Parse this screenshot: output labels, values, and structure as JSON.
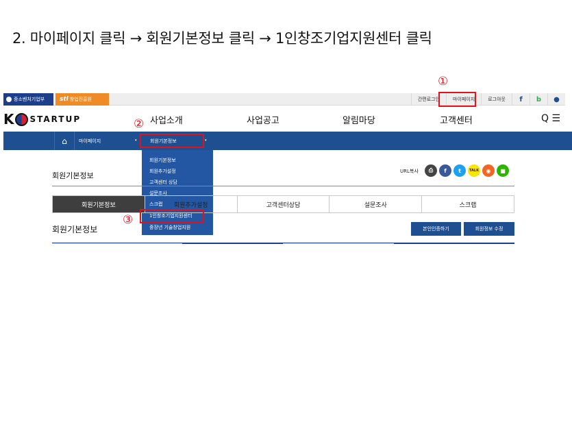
{
  "instruction": "2. 마이페이지 클릭 → 회원기본정보 클릭 → 1인창조기업지원센터 클릭",
  "util_bar": {
    "left_1": "중소벤처기업부",
    "left_2_logo": "stl",
    "left_2_label": "창업진흥원",
    "links": [
      "간편로그인",
      "마이페이지",
      "로그아웃"
    ],
    "sns": [
      "f",
      "b",
      "●"
    ]
  },
  "header": {
    "logo_k": "K",
    "logo_text": "STARTUP",
    "gnb": [
      "사업소개",
      "사업공고",
      "알림마당",
      "고객센터"
    ],
    "icons": "Q ☰"
  },
  "subnav": {
    "home_icon": "⌂",
    "crumb_1": "마이페이지",
    "crumb_2": "회원기본정보",
    "caret": "▾"
  },
  "dropdown": [
    "회원기본정보",
    "회원추가설정",
    "고객센터 상담",
    "설문조사",
    "스크랩",
    "1인창조기업지원센터",
    "중장년 기술창업지원"
  ],
  "content": {
    "page_title": "회원기본정보",
    "url_copy": "URL복사",
    "sns_share": [
      "⎙",
      "f",
      "t",
      "TALK",
      "◉",
      "■"
    ],
    "tabs": [
      "회원기본정보",
      "회원추가설정",
      "고객센터상담",
      "설문조사",
      "스크랩"
    ],
    "section_title": "회원기본정보",
    "btn_verify": "본인인증하기",
    "btn_edit": "회원정보 수정"
  },
  "marks": [
    "①",
    "②",
    "③"
  ],
  "colors": {
    "brand_blue": "#1d4f91",
    "highlight_red": "#e0131d",
    "orange": "#f08a24"
  }
}
